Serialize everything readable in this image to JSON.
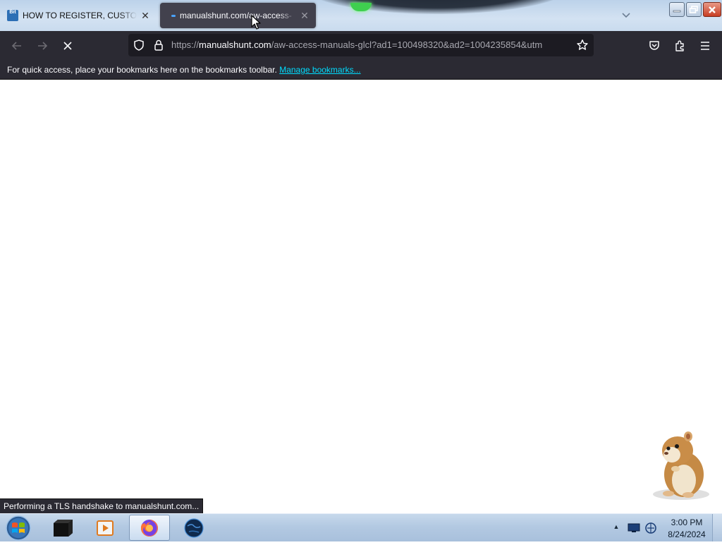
{
  "browser": {
    "tabs": [
      {
        "title": "HOW TO REGISTER, CUSTOMIZE",
        "favicon_text": "Bit",
        "active": false
      },
      {
        "title": "manualshunt.com/aw-access-",
        "loading": true,
        "active": true
      }
    ],
    "url": {
      "scheme": "https://",
      "host": "manualshunt.com",
      "path": "/aw-access-manuals-glcl?ad1=100498320&ad2=1004235854&utm"
    },
    "bookmarks_toolbar": {
      "message": "For quick access, place your bookmarks here on the bookmarks toolbar.",
      "link": "Manage bookmarks..."
    },
    "status": "Performing a TLS handshake to manualshunt.com..."
  },
  "taskbar": {
    "clock_time": "3:00 PM",
    "clock_date": "8/24/2024",
    "pinned": [
      "terminal-icon",
      "media-player-icon",
      "firefox-icon",
      "globe-icon"
    ]
  },
  "colors": {
    "toolbar": "#2b2a33",
    "urlbar": "#1c1b22",
    "link": "#00ddff",
    "taskbar": "#b3c9e2"
  }
}
